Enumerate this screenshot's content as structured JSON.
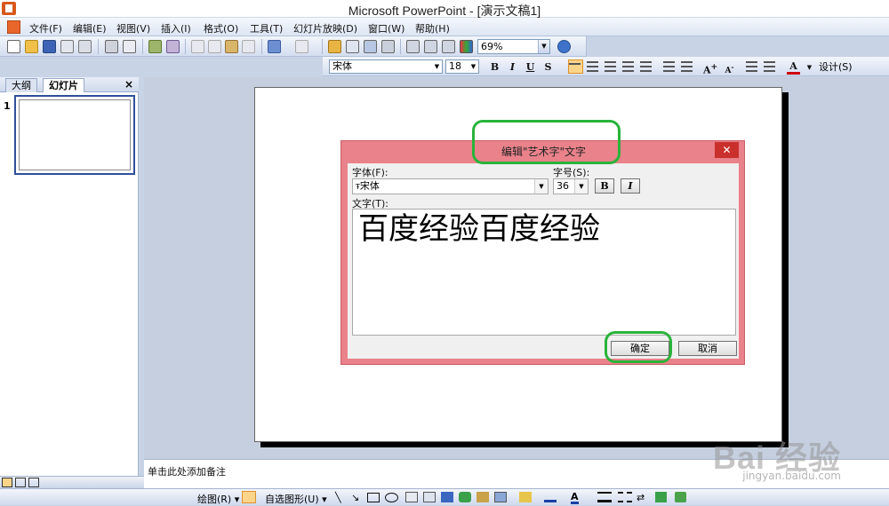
{
  "window": {
    "title": "Microsoft PowerPoint - [演示文稿1]"
  },
  "menubar": {
    "items": [
      "文件(F)",
      "编辑(E)",
      "视图(V)",
      "插入(I)",
      "格式(O)",
      "工具(T)",
      "幻灯片放映(D)",
      "窗口(W)",
      "帮助(H)"
    ]
  },
  "toolbar": {
    "zoom": "69%"
  },
  "format_toolbar": {
    "font": "宋体",
    "size": "18",
    "bold": "B",
    "italic": "I",
    "underline": "U",
    "shadow": "S",
    "design": "设计(S)"
  },
  "left_pane": {
    "tabs": [
      "大纲",
      "幻灯片"
    ],
    "close": "×",
    "slide_number": "1"
  },
  "notes": {
    "placeholder": "单击此处添加备注"
  },
  "drawing_toolbar": {
    "draw": "绘图(R)",
    "autoshapes": "自选图形(U)"
  },
  "dialog": {
    "title": "编辑\"艺术字\"文字",
    "close": "✕",
    "font_label": "字体(F):",
    "font_value": "宋体",
    "size_label": "字号(S):",
    "size_value": "36",
    "bold": "B",
    "italic": "I",
    "text_label": "文字(T):",
    "text_value": "百度经验百度经验",
    "ok": "确定",
    "cancel": "取消"
  },
  "highlight_color": "#29b33a",
  "watermark": {
    "text": "Bai 经验",
    "sub": "jingyan.baidu.com"
  }
}
